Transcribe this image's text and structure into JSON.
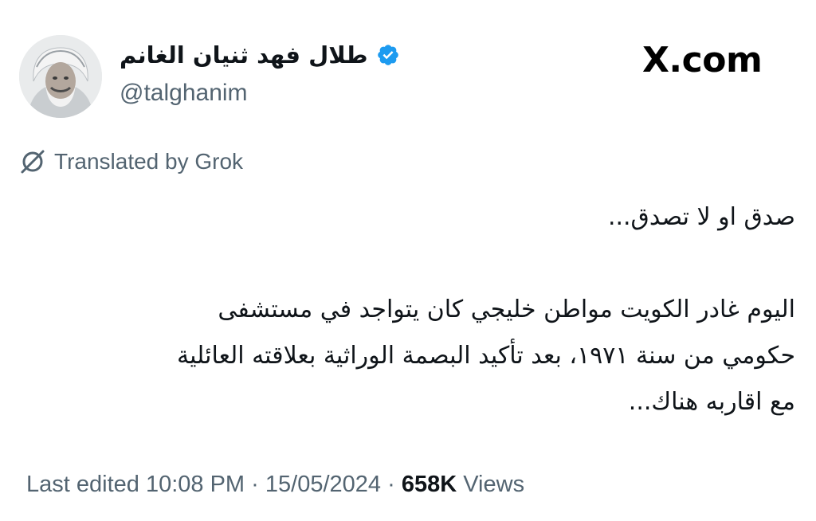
{
  "brand": {
    "logo_text": "X.com"
  },
  "author": {
    "display_name": "طلال فهد ثنيان الغانم",
    "handle": "@talghanim",
    "verified": true,
    "verified_color": "#1d9bf0"
  },
  "translation": {
    "label": "Translated by Grok",
    "icon": "grok-icon"
  },
  "tweet": {
    "lines": [
      "صدق او لا تصدق...",
      "",
      "اليوم غادر الكويت مواطن خليجي كان يتواجد في مستشفى",
      "حكومي من سنة ١٩٧١، بعد تأكيد البصمة الوراثية بعلاقته العائلية",
      "مع اقاربه هناك..."
    ]
  },
  "meta": {
    "edited_label": "Last edited",
    "time": "10:08 PM",
    "date": "15/05/2024",
    "views_count": "658K",
    "views_label": "Views",
    "separator": "·"
  },
  "colors": {
    "text": "#0f1419",
    "secondary": "#536471",
    "accent": "#1d9bf0"
  }
}
